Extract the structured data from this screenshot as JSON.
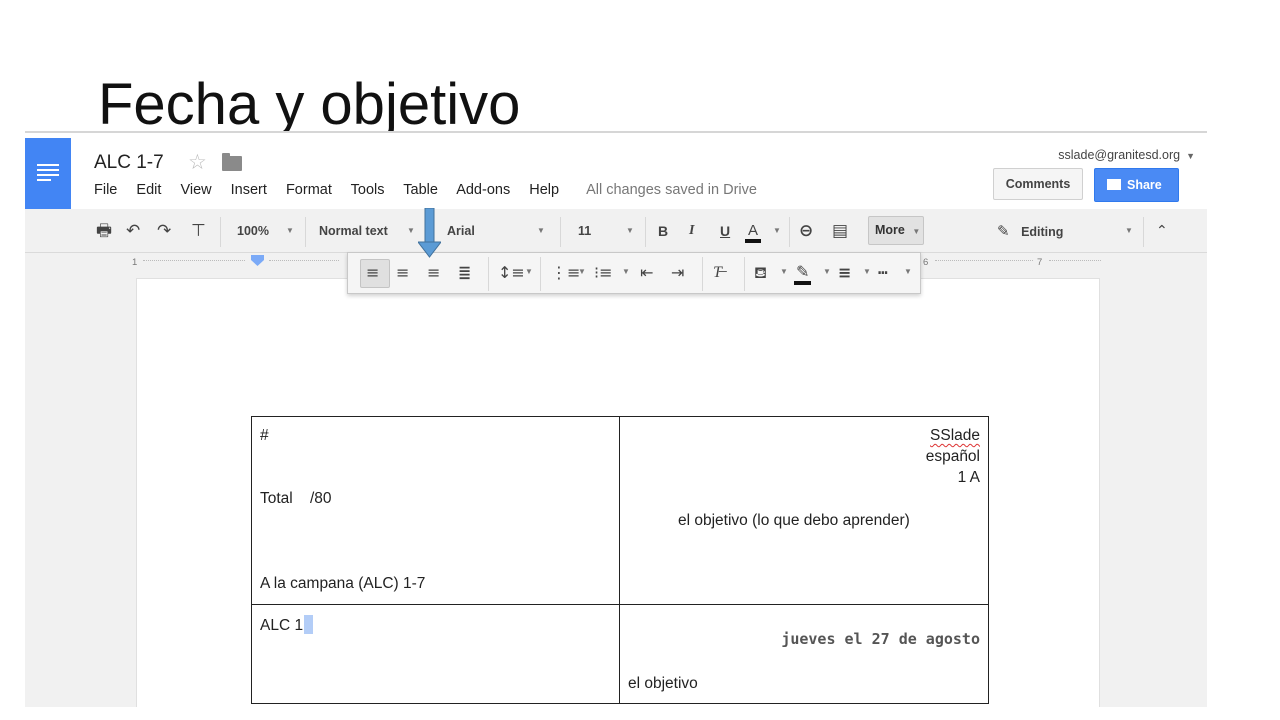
{
  "slide": {
    "title": "Fecha y objetivo"
  },
  "header": {
    "doc_title": "ALC 1-7",
    "menu": [
      "File",
      "Edit",
      "View",
      "Insert",
      "Format",
      "Tools",
      "Table",
      "Add-ons",
      "Help"
    ],
    "save_status": "All changes saved in Drive",
    "account": "sslade@granitesd.org",
    "comments_label": "Comments",
    "share_label": "Share"
  },
  "toolbar": {
    "zoom": "100%",
    "style": "Normal text",
    "font": "Arial",
    "font_size": "11",
    "bold": "B",
    "italic": "I",
    "underline": "U",
    "text_color": "A",
    "more": "More",
    "mode": "Editing"
  },
  "ruler": {
    "numbers": [
      "1",
      "6",
      "7"
    ]
  },
  "document": {
    "table": {
      "r1_left": {
        "hash": "#",
        "total": "Total    /80",
        "bell": "A la campana (ALC) 1-7"
      },
      "r1_right": {
        "name": "SSlade",
        "subject": "español",
        "period": "1 A",
        "objective": "el objetivo (lo que debo aprender)"
      },
      "r2_left": {
        "text": "ALC 1"
      },
      "r2_right": {
        "date": "jueves el 27 de agosto",
        "objective": "el objetivo"
      }
    }
  },
  "colors": {
    "docs_blue": "#4285f4",
    "share_blue": "#4a8af4",
    "arrow_blue": "#5b9bd5",
    "selection": "#b3cdf7"
  }
}
